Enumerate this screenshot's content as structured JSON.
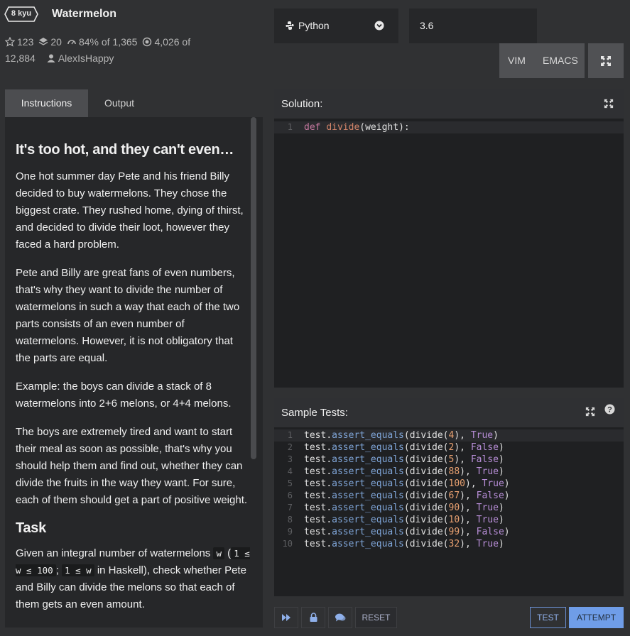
{
  "kata": {
    "rank": "8 kyu",
    "title": "Watermelon",
    "stats": {
      "stars": "123",
      "collections": "20",
      "satisfaction": "84%",
      "votes": "of 1,365",
      "completed": "4,026",
      "completed_of": "of",
      "attempts": "12,884",
      "author": "AlexIsHappy"
    }
  },
  "editor_header": {
    "language": "Python",
    "version": "3.6",
    "keymaps": [
      "VIM",
      "EMACS"
    ]
  },
  "tabs": [
    "Instructions",
    "Output"
  ],
  "description": {
    "heading": "It's too hot, and they can't even…",
    "paragraphs": [
      "One hot summer day Pete and his friend Billy decided to buy watermelons. They chose the biggest crate. They rushed home, dying of thirst, and decided to divide their loot, however they faced a hard problem.",
      "Pete and Billy are great fans of even numbers, that's why they want to divide the number of watermelons in such a way that each of the two parts consists of an even number of watermelons. However, it is not obligatory that the parts are equal.",
      "Example: the boys can divide a stack of 8 watermelons into 2+6 melons, or 4+4 melons.",
      "The boys are extremely tired and want to start their meal as soon as possible, that's why you should help them and find out, whether they can divide the fruits in the way they want. For sure, each of them should get a part of positive weight."
    ],
    "task_heading": "Task",
    "task": {
      "t1": "Given an integral number of watermelons ",
      "c1": "w",
      "t2": " (",
      "c2": "1 ≤ w ≤ 100",
      "t3": "; ",
      "c3": "1 ≤ w",
      "t4": " in Haskell), check whether Pete and Billy can divide the melons so that each of them gets an even amount."
    }
  },
  "solution": {
    "title": "Solution:",
    "lines": [
      {
        "num": "1",
        "kw": "def ",
        "fn": "divide",
        "rest": "(weight):"
      }
    ]
  },
  "sample_tests": {
    "title": "Sample Tests:",
    "lines": [
      {
        "num": "1",
        "arg": "4",
        "res": "True"
      },
      {
        "num": "2",
        "arg": "2",
        "res": "False"
      },
      {
        "num": "3",
        "arg": "5",
        "res": "False"
      },
      {
        "num": "4",
        "arg": "88",
        "res": "True"
      },
      {
        "num": "5",
        "arg": "100",
        "res": "True"
      },
      {
        "num": "6",
        "arg": "67",
        "res": "False"
      },
      {
        "num": "7",
        "arg": "90",
        "res": "True"
      },
      {
        "num": "8",
        "arg": "10",
        "res": "True"
      },
      {
        "num": "9",
        "arg": "99",
        "res": "False"
      },
      {
        "num": "10",
        "arg": "32",
        "res": "True"
      }
    ]
  },
  "toolbar": {
    "reset": "RESET",
    "test": "TEST",
    "attempt": "ATTEMPT"
  },
  "colors": {
    "background": "#303133",
    "panel": "#262729",
    "accent": "#6f9de8"
  }
}
